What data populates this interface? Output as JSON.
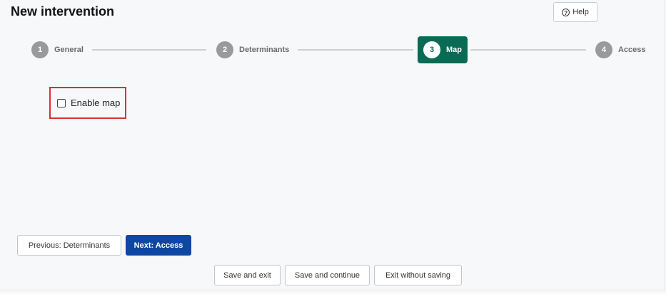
{
  "header": {
    "title": "New intervention",
    "help_label": "Help"
  },
  "stepper": {
    "steps": [
      {
        "number": "1",
        "label": "General"
      },
      {
        "number": "2",
        "label": "Determinants"
      },
      {
        "number": "3",
        "label": "Map",
        "active": true
      },
      {
        "number": "4",
        "label": "Access"
      }
    ]
  },
  "form": {
    "enable_map_label": "Enable map",
    "enable_map_checked": false
  },
  "navigation": {
    "previous_label": "Previous: Determinants",
    "next_label": "Next: Access"
  },
  "actions": {
    "save_exit_label": "Save and exit",
    "save_continue_label": "Save and continue",
    "exit_without_saving_label": "Exit without saving"
  },
  "colors": {
    "active_step": "#0a6b55",
    "primary_button": "#0e46a3",
    "highlight_border": "#d9312f"
  }
}
